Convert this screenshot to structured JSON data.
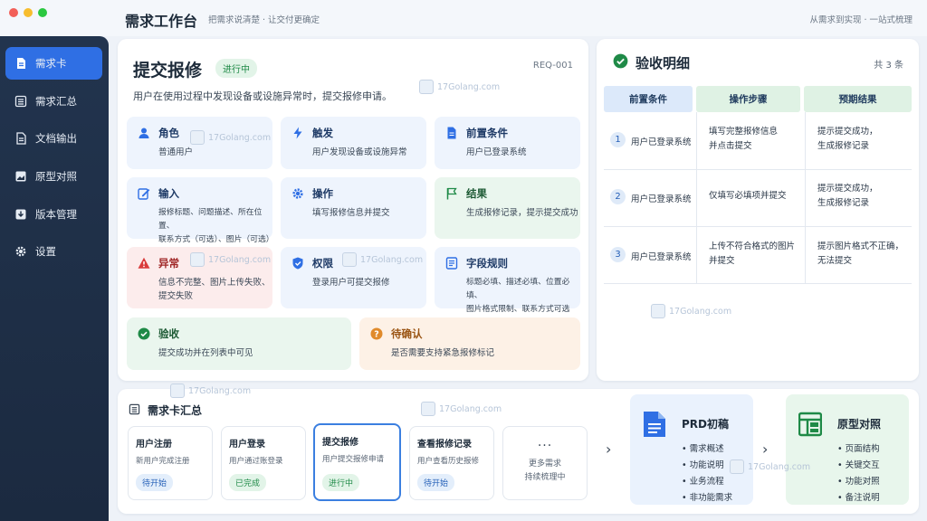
{
  "window": {
    "dot_colors": [
      "#f25f58",
      "#f7bd2e",
      "#2bc840"
    ]
  },
  "header": {
    "title": "需求工作台",
    "subtitle": "把需求说清楚 · 让交付更确定",
    "right_text": "从需求到实现 · 一站式梳理"
  },
  "sidebar": {
    "items": [
      {
        "label": "需求卡",
        "icon": "document-icon",
        "active": true
      },
      {
        "label": "需求汇总",
        "icon": "list-icon"
      },
      {
        "label": "文档输出",
        "icon": "file-icon"
      },
      {
        "label": "原型对照",
        "icon": "prototype-icon"
      },
      {
        "label": "版本管理",
        "icon": "download-icon"
      },
      {
        "label": "设置",
        "icon": "gear-icon"
      }
    ]
  },
  "requirement": {
    "title": "提交报修",
    "status": "进行中",
    "id": "REQ-001",
    "description": "用户在使用过程中发现设备或设施异常时，提交报修申请。",
    "tiles": [
      {
        "title": "角色",
        "body": "普通用户",
        "icon": "user-icon"
      },
      {
        "title": "触发",
        "body": "用户发现设备或设施异常",
        "icon": "lightning-icon"
      },
      {
        "title": "前置条件",
        "body": "用户已登录系统",
        "icon": "document-icon"
      },
      {
        "title": "输入",
        "body": "报修标题、问题描述、所在位置、\n联系方式（可选）、图片（可选）",
        "icon": "edit-icon"
      },
      {
        "title": "操作",
        "body": "填写报修信息并提交",
        "icon": "gear-icon"
      },
      {
        "title": "结果",
        "body": "生成报修记录，提示提交成功",
        "icon": "flag-icon"
      },
      {
        "title": "异常",
        "body": "信息不完整、图片上传失败、\n提交失败",
        "icon": "warning-icon"
      },
      {
        "title": "权限",
        "body": "登录用户可提交报修",
        "icon": "shield-icon"
      },
      {
        "title": "字段规则",
        "body": "标题必填、描述必填、位置必填、\n图片格式限制、联系方式可选",
        "icon": "rules-icon"
      },
      {
        "title": "验收",
        "body": "提交成功并在列表中可见",
        "icon": "check-circle-icon"
      },
      {
        "title": "待确认",
        "body": "是否需要支持紧急报修标记",
        "icon": "question-icon"
      }
    ]
  },
  "acceptance": {
    "title": "验收明细",
    "count": "共 3 条",
    "columns": [
      "前置条件",
      "操作步骤",
      "预期结果"
    ],
    "rows": [
      {
        "num": "1",
        "pre": "用户已登录系统",
        "step": "填写完整报修信息\n并点击提交",
        "result": "提示提交成功，\n生成报修记录"
      },
      {
        "num": "2",
        "pre": "用户已登录系统",
        "step": "仅填写必填项并提交",
        "result": "提示提交成功，\n生成报修记录"
      },
      {
        "num": "3",
        "pre": "用户已登录系统",
        "step": "上传不符合格式的图片\n并提交",
        "result": "提示图片格式不正确，\n无法提交"
      }
    ]
  },
  "summary": {
    "title": "需求卡汇总",
    "items": [
      {
        "title": "用户注册",
        "desc": "新用户完成注册",
        "status": "待开始"
      },
      {
        "title": "用户登录",
        "desc": "用户通过账登录",
        "status": "已完成"
      },
      {
        "title": "提交报修",
        "desc": "用户提交报修申请",
        "status": "进行中"
      },
      {
        "title": "查看报修记录",
        "desc": "用户查看历史报修",
        "status": "待开始"
      }
    ],
    "more": {
      "dots": "···",
      "text": "更多需求\n持续梳理中"
    }
  },
  "outputs": {
    "prd": {
      "title": "PRD初稿",
      "items": [
        "需求概述",
        "功能说明",
        "业务流程",
        "非功能需求"
      ]
    },
    "proto": {
      "title": "原型对照",
      "items": [
        "页面结构",
        "关键交互",
        "功能对照",
        "备注说明"
      ]
    }
  },
  "watermark": "17Golang.com",
  "colors": {
    "accent": "#2f6fe4",
    "sidebar": "#1f2f46",
    "success": "#1f8a47",
    "danger": "#d93b3b",
    "warning": "#e08a2a"
  }
}
